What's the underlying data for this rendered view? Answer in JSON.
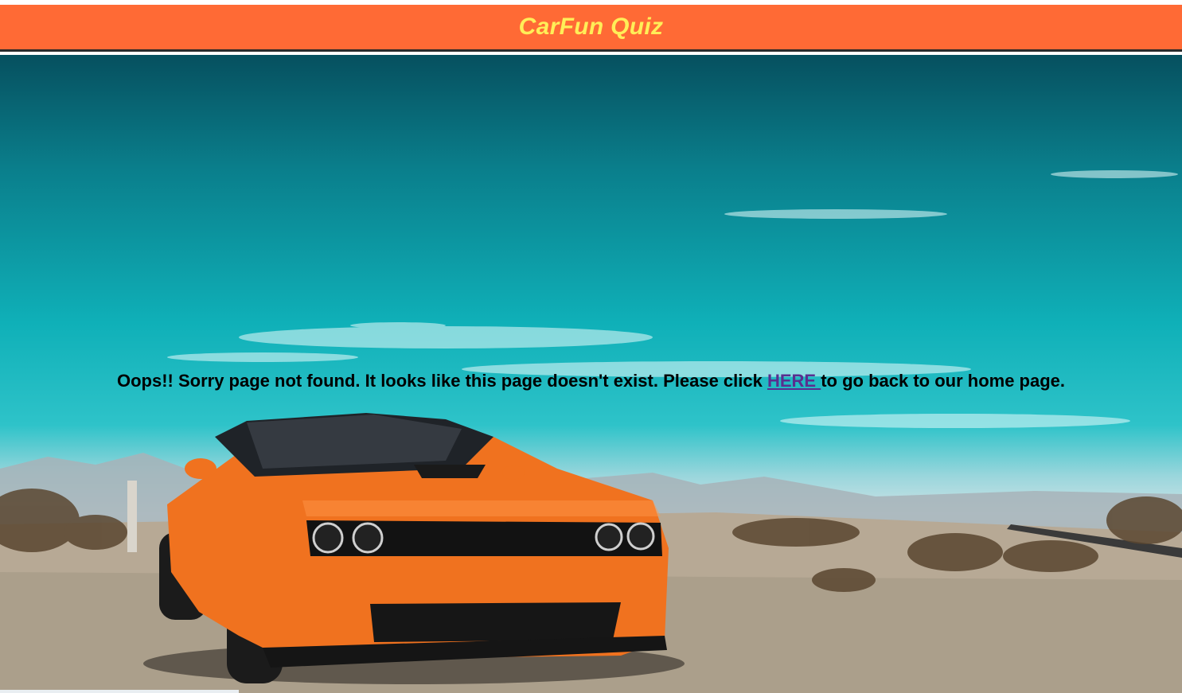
{
  "header": {
    "title": "CarFun Quiz"
  },
  "message": {
    "text_before": "Oops!! Sorry page not found. It looks like this page doesn't exist. Please click ",
    "link_text": "HERE ",
    "text_after": "to go back to our home page."
  },
  "hero": {
    "image_subject": "orange-muscle-car-desert-photo"
  },
  "colors": {
    "header_bg": "#ff6a35",
    "header_text": "#ffee58",
    "link": "#5a2f8f",
    "message_text": "#000000"
  }
}
